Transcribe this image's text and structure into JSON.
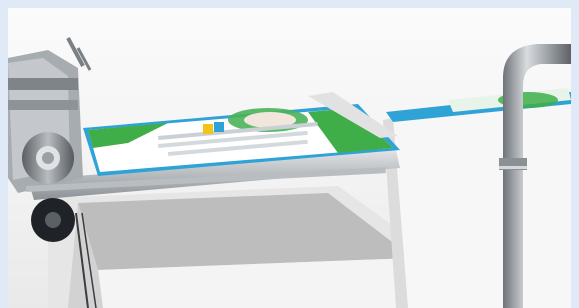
{
  "scene": {
    "kind": "product-illustration",
    "subject": "paper-feeding-machine",
    "frame_color": "#dfeaf6",
    "accent_blue": "#2fa3d6",
    "accent_green": "#3fae49",
    "metal_gray": "#9ea3a8"
  }
}
